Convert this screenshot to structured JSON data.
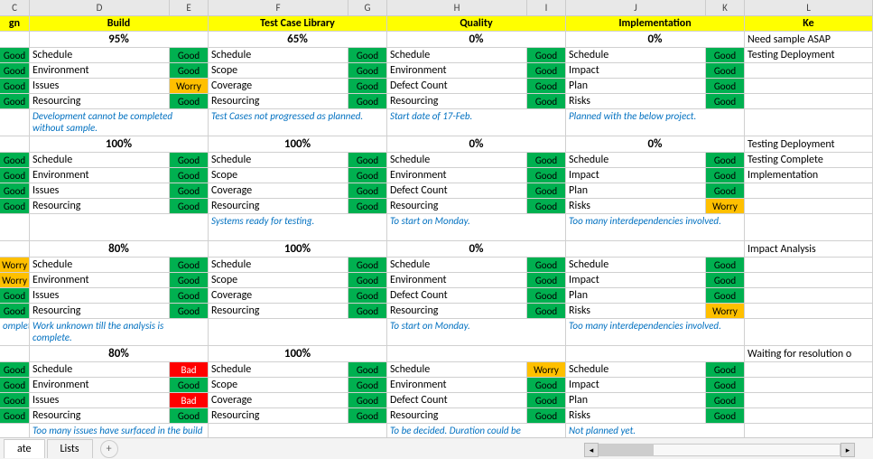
{
  "columns": [
    "C",
    "D",
    "E",
    "F",
    "G",
    "H",
    "I",
    "J",
    "K",
    "L"
  ],
  "headers": {
    "gn": "gn",
    "build": "Build",
    "tcl": "Test Case Library",
    "quality": "Quality",
    "impl": "Implementation",
    "ke": "Ke"
  },
  "labels": {
    "schedule": "Schedule",
    "environment": "Environment",
    "issues": "Issues",
    "resourcing": "Resourcing",
    "scope": "Scope",
    "coverage": "Coverage",
    "defect": "Defect Count",
    "impact": "Impact",
    "plan": "Plan",
    "risks": "Risks"
  },
  "status": {
    "good": "Good",
    "worry": "Worry",
    "bad": "Bad"
  },
  "blocks": [
    {
      "pct": {
        "build": "95%",
        "tcl": "65%",
        "quality": "0%",
        "impl": "0%"
      },
      "sidenote": "Need sample ASAP",
      "sidenote2": "Testing Deployment",
      "rows": [
        {
          "c": "good",
          "build": "good",
          "tcl": "good",
          "quality": "good",
          "impl": "good",
          "b": "schedule",
          "t": "schedule",
          "q": "schedule",
          "i": "schedule"
        },
        {
          "c": "good",
          "build": "good",
          "tcl": "good",
          "quality": "good",
          "impl": "good",
          "b": "environment",
          "t": "scope",
          "q": "environment",
          "i": "impact"
        },
        {
          "c": "good",
          "build": "worry",
          "tcl": "good",
          "quality": "good",
          "impl": "good",
          "b": "issues",
          "t": "coverage",
          "q": "defect",
          "i": "plan"
        },
        {
          "c": "good",
          "build": "good",
          "tcl": "good",
          "quality": "good",
          "impl": "good",
          "b": "resourcing",
          "t": "resourcing",
          "q": "resourcing",
          "i": "risks"
        }
      ],
      "notes": {
        "build": "Development cannot be completed without sample.",
        "tcl": "Test Cases not progressed as planned.",
        "quality": "Start date of 17-Feb.",
        "impl": "Planned with the below project."
      }
    },
    {
      "pct": {
        "build": "100%",
        "tcl": "100%",
        "quality": "0%",
        "impl": "0%"
      },
      "sidenote": "Testing Deployment",
      "sidenote2": "Testing Complete",
      "sidenote3": "Implementation",
      "rows": [
        {
          "c": "good",
          "build": "good",
          "tcl": "good",
          "quality": "good",
          "impl": "good",
          "b": "schedule",
          "t": "schedule",
          "q": "schedule",
          "i": "schedule"
        },
        {
          "c": "good",
          "build": "good",
          "tcl": "good",
          "quality": "good",
          "impl": "good",
          "b": "environment",
          "t": "scope",
          "q": "environment",
          "i": "impact"
        },
        {
          "c": "good",
          "build": "good",
          "tcl": "good",
          "quality": "good",
          "impl": "good",
          "b": "issues",
          "t": "coverage",
          "q": "defect",
          "i": "plan"
        },
        {
          "c": "good",
          "build": "good",
          "tcl": "good",
          "quality": "good",
          "impl": "worry",
          "b": "resourcing",
          "t": "resourcing",
          "q": "resourcing",
          "i": "risks"
        }
      ],
      "notes": {
        "build": "",
        "tcl": "Systems ready for testing.",
        "quality": "To start on Monday.",
        "impl": "Too many interdependencies involved."
      }
    },
    {
      "pct": {
        "build": "80%",
        "tcl": "100%",
        "quality": "0%",
        "impl": ""
      },
      "sidenote": "Impact Analysis",
      "rows": [
        {
          "c": "worry",
          "build": "good",
          "tcl": "good",
          "quality": "good",
          "impl": "good",
          "b": "schedule",
          "t": "schedule",
          "q": "schedule",
          "i": "schedule"
        },
        {
          "c": "worry",
          "build": "good",
          "tcl": "good",
          "quality": "good",
          "impl": "good",
          "b": "environment",
          "t": "scope",
          "q": "environment",
          "i": "impact"
        },
        {
          "c": "good",
          "build": "good",
          "tcl": "good",
          "quality": "good",
          "impl": "good",
          "b": "issues",
          "t": "coverage",
          "q": "defect",
          "i": "plan"
        },
        {
          "c": "good",
          "build": "good",
          "tcl": "good",
          "quality": "good",
          "impl": "worry",
          "b": "resourcing",
          "t": "resourcing",
          "q": "resourcing",
          "i": "risks"
        }
      ],
      "notepre": "ompleted",
      "notes": {
        "build": "Work unknown till the analysis is complete.",
        "tcl": "",
        "quality": "To start on Monday.",
        "impl": "Too many interdependencies involved."
      }
    },
    {
      "pct": {
        "build": "80%",
        "tcl": "100%",
        "quality": "",
        "impl": ""
      },
      "sidenote": "Waiting for resolution o",
      "rows": [
        {
          "c": "good",
          "build": "bad",
          "tcl": "good",
          "quality": "worry",
          "impl": "good",
          "b": "schedule",
          "t": "schedule",
          "q": "schedule",
          "i": "schedule"
        },
        {
          "c": "good",
          "build": "good",
          "tcl": "good",
          "quality": "good",
          "impl": "good",
          "b": "environment",
          "t": "scope",
          "q": "environment",
          "i": "impact"
        },
        {
          "c": "good",
          "build": "bad",
          "tcl": "good",
          "quality": "good",
          "impl": "good",
          "b": "issues",
          "t": "coverage",
          "q": "defect",
          "i": "plan"
        },
        {
          "c": "good",
          "build": "good",
          "tcl": "good",
          "quality": "good",
          "impl": "good",
          "b": "resourcing",
          "t": "resourcing",
          "q": "resourcing",
          "i": "risks"
        }
      ],
      "notes": {
        "build": "Too many issues have surfaced in the build phase.",
        "tcl": "",
        "quality": "To be decided. Duration could be underestimated.",
        "impl": "Not planned yet."
      }
    }
  ],
  "tabs": {
    "active": "ate",
    "second": "Lists"
  }
}
